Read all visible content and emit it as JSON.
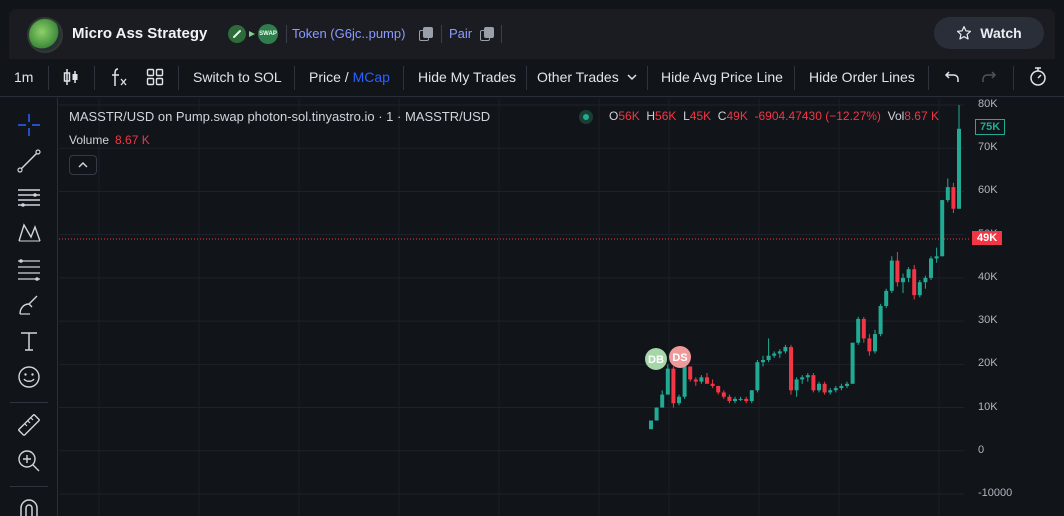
{
  "header": {
    "title": "Micro Ass Strategy",
    "swap_badge": "SWAP",
    "token_link": "Token (G6jc..pump)",
    "pair_link": "Pair",
    "watch_label": "Watch"
  },
  "toolbar": {
    "interval": "1m",
    "switch_to_sol": "Switch to SOL",
    "price_label": "Price",
    "price_sep": "/",
    "mcap_label": "MCap",
    "hide_my_trades": "Hide My Trades",
    "other_trades": "Other Trades",
    "hide_avg_price_line": "Hide Avg Price Line",
    "hide_order_lines": "Hide Order Lines"
  },
  "legend": {
    "symbol_line": "MASSTR/USD on Pump.swap photon-sol.tinyastro.io · 1 · MASSTR/USD",
    "o_key": "O",
    "o_val": "56K",
    "h_key": "H",
    "h_val": "56K",
    "l_key": "L",
    "l_val": "45K",
    "c_key": "C",
    "c_val": "49K",
    "change": "-6904.47430 (−12.27%)",
    "vol_key": "Vol",
    "vol_val": "8.67 K",
    "volume_label": "Volume",
    "volume_val": "8.67 K"
  },
  "axis": {
    "ticks": [
      "80K",
      "70K",
      "60K",
      "50K",
      "40K",
      "30K",
      "20K",
      "10K",
      "0",
      "-10000"
    ],
    "current_price_tag": "75K",
    "last_close_tag": "49K"
  },
  "markers": {
    "buy": "DB",
    "sell": "DS"
  },
  "colors": {
    "up": "#22ab94",
    "down": "#f23645",
    "accent": "#2962ff",
    "link": "#8b9bff"
  },
  "chart_data": {
    "type": "candlestick",
    "ylim": [
      -10000,
      80000
    ],
    "candles": [
      [
        5000,
        7000,
        5000,
        7000
      ],
      [
        7000,
        10000,
        7000,
        10000
      ],
      [
        10000,
        14000,
        10000,
        13000
      ],
      [
        13000,
        20000,
        13000,
        19000
      ],
      [
        19000,
        19500,
        10000,
        11000
      ],
      [
        11000,
        13000,
        10500,
        12500
      ],
      [
        12500,
        20000,
        12000,
        19500
      ],
      [
        19500,
        19500,
        16000,
        16500
      ],
      [
        16500,
        17000,
        15000,
        16000
      ],
      [
        16000,
        17500,
        15500,
        17000
      ],
      [
        17000,
        18000,
        15500,
        15500
      ],
      [
        15500,
        16500,
        14500,
        15000
      ],
      [
        15000,
        15000,
        13000,
        13500
      ],
      [
        13500,
        14000,
        12000,
        12500
      ],
      [
        12500,
        13000,
        11000,
        11500
      ],
      [
        11500,
        12500,
        11000,
        12000
      ],
      [
        12000,
        12500,
        11500,
        12000
      ],
      [
        12000,
        12500,
        11000,
        11500
      ],
      [
        11500,
        14000,
        11000,
        14000
      ],
      [
        14000,
        21000,
        13500,
        20500
      ],
      [
        20500,
        22000,
        19500,
        21000
      ],
      [
        21000,
        26000,
        20500,
        22000
      ],
      [
        22000,
        23000,
        21500,
        22500
      ],
      [
        22500,
        23500,
        21500,
        23000
      ],
      [
        23000,
        24500,
        22500,
        24000
      ],
      [
        24000,
        24500,
        13000,
        14000
      ],
      [
        14000,
        17000,
        12500,
        16500
      ],
      [
        16500,
        17500,
        15500,
        17000
      ],
      [
        17000,
        18000,
        16000,
        17500
      ],
      [
        17500,
        18000,
        13500,
        14000
      ],
      [
        14000,
        16000,
        13500,
        15500
      ],
      [
        15500,
        16000,
        13000,
        13500
      ],
      [
        13500,
        14500,
        13000,
        14000
      ],
      [
        14000,
        15000,
        13500,
        14500
      ],
      [
        14500,
        15500,
        14000,
        15000
      ],
      [
        15000,
        16000,
        14500,
        15500
      ],
      [
        15500,
        25000,
        15500,
        25000
      ],
      [
        25000,
        31000,
        24500,
        30500
      ],
      [
        30500,
        31000,
        25000,
        26000
      ],
      [
        26000,
        27000,
        22000,
        23000
      ],
      [
        23000,
        28000,
        22500,
        27000
      ],
      [
        27000,
        34000,
        26500,
        33500
      ],
      [
        33500,
        37500,
        33000,
        37000
      ],
      [
        37000,
        45000,
        36500,
        44000
      ],
      [
        44000,
        46000,
        38000,
        39000
      ],
      [
        39000,
        41000,
        36500,
        40000
      ],
      [
        40000,
        42500,
        39000,
        42000
      ],
      [
        42000,
        43000,
        35000,
        36000
      ],
      [
        36000,
        39500,
        35500,
        39000
      ],
      [
        39000,
        40500,
        37500,
        40000
      ],
      [
        40000,
        45000,
        39500,
        44500
      ],
      [
        44500,
        47000,
        43500,
        45000
      ],
      [
        45000,
        58000,
        45000,
        58000
      ],
      [
        58000,
        63000,
        57500,
        61000
      ],
      [
        61000,
        62000,
        55000,
        56000
      ],
      [
        56000,
        80000,
        56000,
        74500
      ]
    ]
  }
}
